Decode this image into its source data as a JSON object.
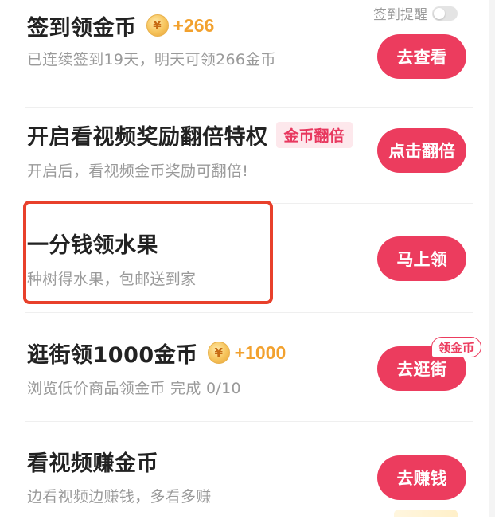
{
  "checkin_reminder": {
    "label": "签到提醒",
    "enabled": false
  },
  "tasks": [
    {
      "title": "签到领金币",
      "reward": "+266",
      "subtitle": "已连续签到19天，明天可领266金币",
      "button": "去查看"
    },
    {
      "title": "开启看视频奖励翻倍特权",
      "tag": "金币翻倍",
      "subtitle": "开启后，看视频金币奖励可翻倍!",
      "button": "点击翻倍"
    },
    {
      "title": "一分钱领水果",
      "subtitle": "种树得水果，包邮送到家",
      "button": "马上领"
    },
    {
      "title": "逛街领1000金币",
      "reward": "+1000",
      "subtitle": "浏览低价商品领金币 完成 0/10",
      "button": "去逛街",
      "badge": "领金币"
    },
    {
      "title": "看视频赚金币",
      "subtitle": "边看视频边赚钱，多看多赚",
      "button": "去赚钱"
    }
  ],
  "coin_symbol": "¥",
  "colors": {
    "button": "#ec3c5e",
    "reward": "#f2a12e",
    "tag_bg": "#fde8ec",
    "highlight": "#e8402b"
  }
}
